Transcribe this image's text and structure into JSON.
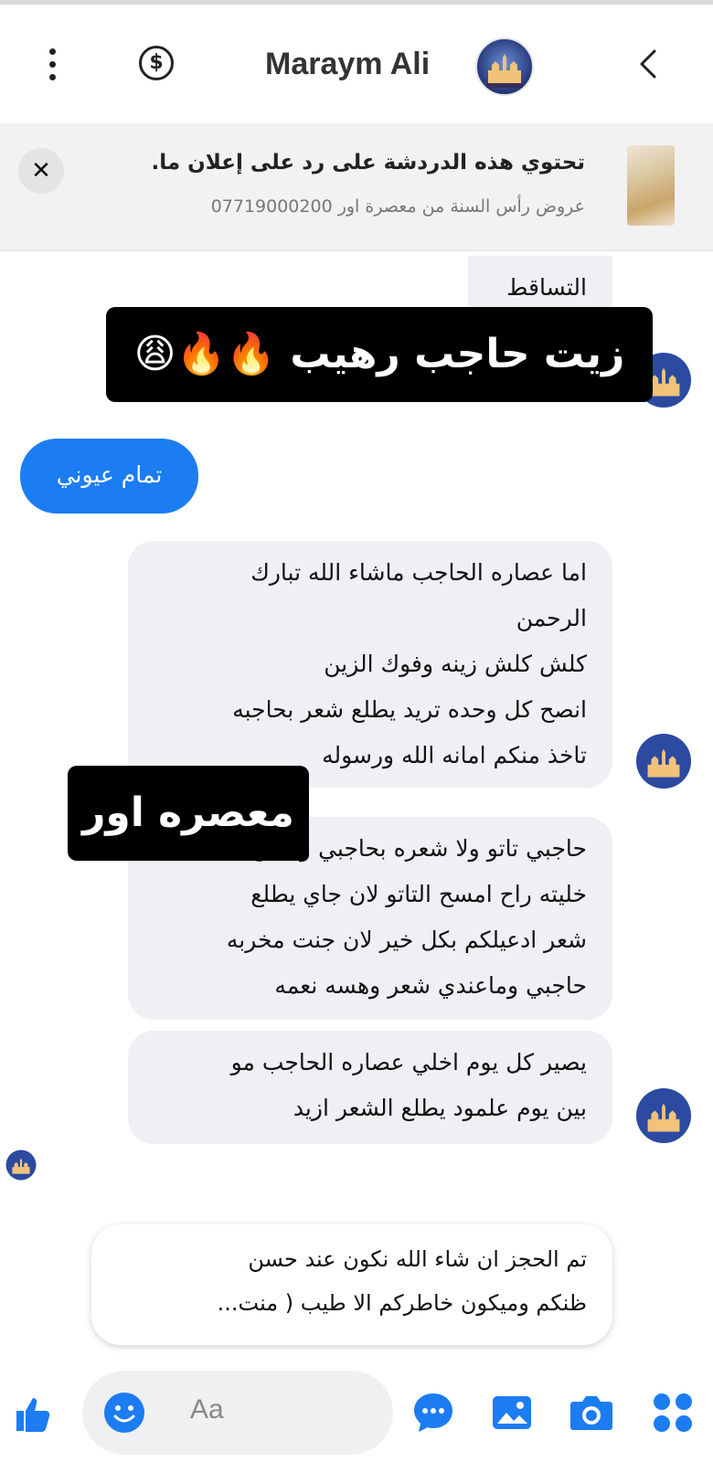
{
  "header": {
    "contact_name": "Maraym Ali",
    "dollar_symbol": "$",
    "icons": [
      "more-vertical-icon",
      "dollar-circle-icon",
      "avatar",
      "chevron-left-icon"
    ]
  },
  "ad_banner": {
    "close_symbol": "✕",
    "title": "تحتوي هذه الدردشة على رد على إعلان ما.",
    "subtitle": "عروض رأس السنة من معصرة اور 07719000200"
  },
  "messages": {
    "m1_partial": "التساقط",
    "overlay_top": "زيت حاجب رهيب 🔥🔥😩",
    "sent_1": "تمام عيوني",
    "m2": [
      "اما عصاره الحاجب ماشاء الله تبارك",
      "الرحمن",
      "كلش كلش زينه وفوك الزين",
      "انصح كل وحده تريد يطلع شعر بحاجبه",
      "تاخذ منكم امانه الله ورسوله"
    ],
    "overlay_middle": "معصره اور",
    "m3": [
      "حاجبي تاتو ولا شعره بحاجبي وكلش",
      "خليته راح امسح التاتو لان جاي يطلع",
      "شعر ادعيلكم بكل خير لان جنت مخربه",
      "حاجبي وماعندي شعر وهسه نعمه"
    ],
    "m4": [
      "يصير كل يوم اخلي عصاره الحاجب مو",
      "بين يوم علمود يطلع الشعر ازيد"
    ],
    "reply": [
      "تم الحجز ان شاء الله نكون عند حسن",
      "ظنكم وميكون خاطركم الا طيب ( منت..."
    ]
  },
  "composer": {
    "placeholder": "Aa"
  },
  "colors": {
    "accent": "#1c7cf2",
    "incoming_bubble": "#eff0f4",
    "banner_bg": "#f2f2f2"
  }
}
